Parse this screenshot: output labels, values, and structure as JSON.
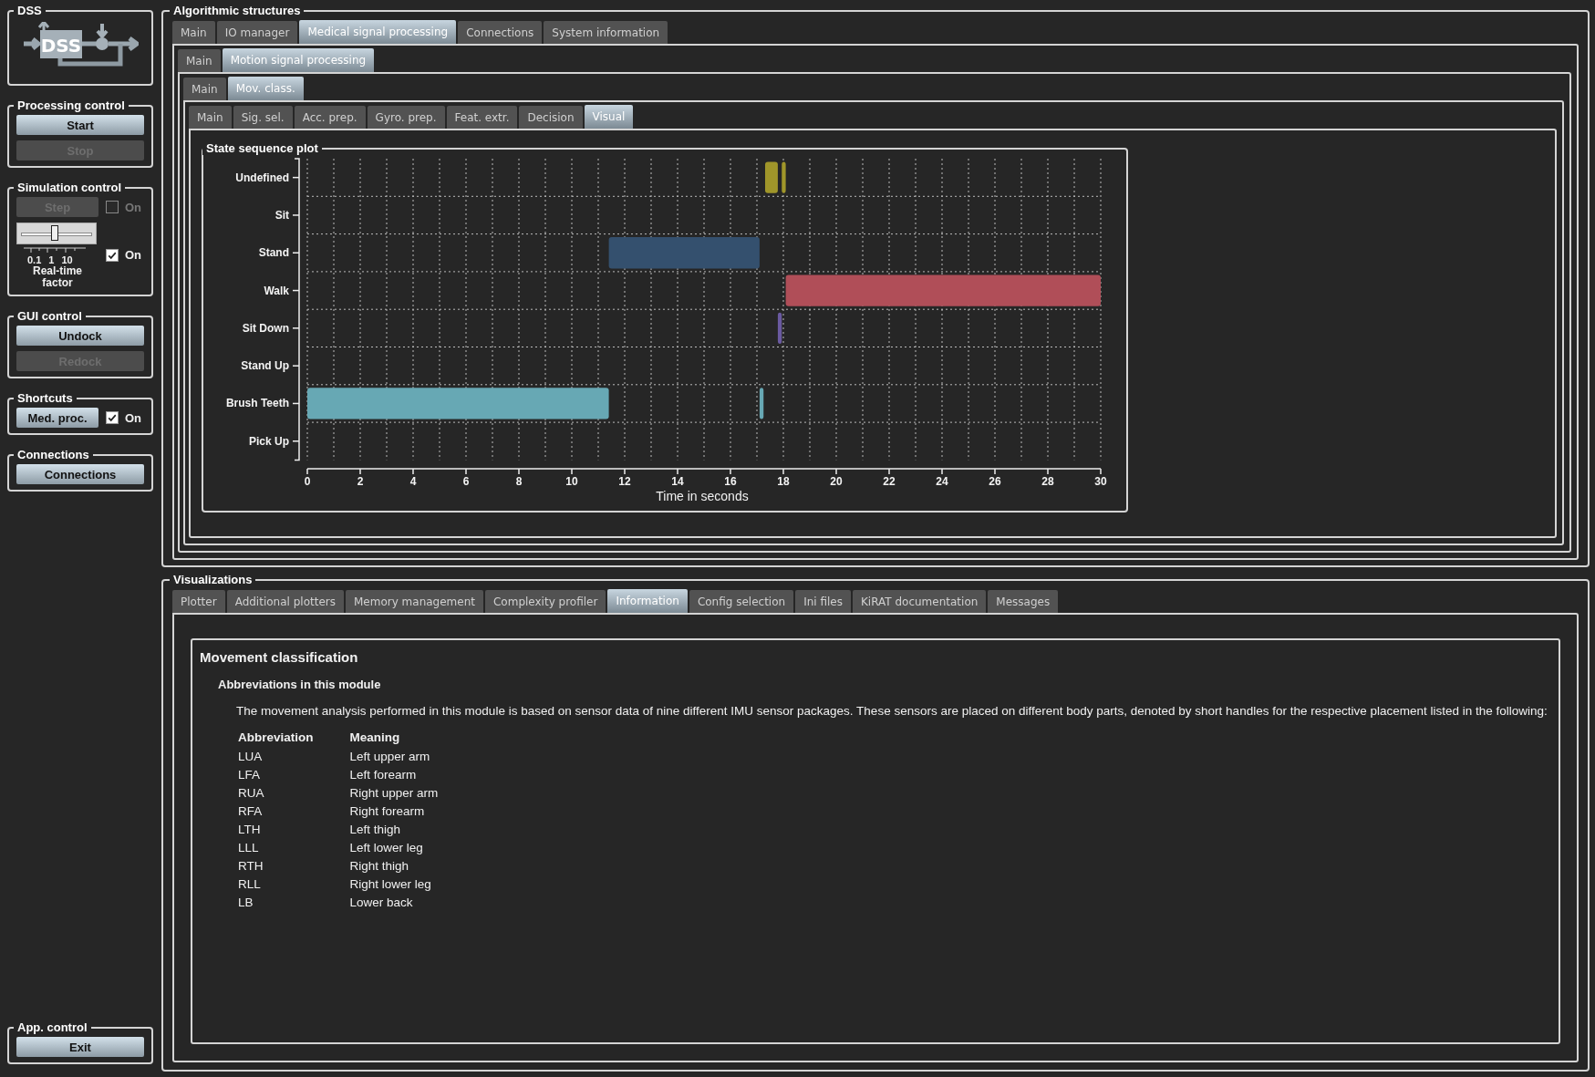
{
  "sidebar": {
    "groups": [
      {
        "kind": "logo",
        "title": "DSS",
        "logo_text": "DSS"
      },
      {
        "kind": "buttons",
        "title": "Processing control",
        "buttons": [
          {
            "label": "Start",
            "disabled": false
          },
          {
            "label": "Stop",
            "disabled": true
          }
        ]
      },
      {
        "kind": "simulation",
        "title": "Simulation control",
        "step": {
          "label": "Step",
          "disabled": true
        },
        "step_toggle": {
          "label": "On",
          "checked": false,
          "disabled": true
        },
        "slider": {
          "level": 0.49,
          "ticks": [
            "0.1",
            "1",
            "10"
          ],
          "caption": "Real-time factor"
        },
        "realtime_toggle": {
          "label": "On",
          "checked": true,
          "disabled": false
        }
      },
      {
        "kind": "buttons",
        "title": "GUI control",
        "buttons": [
          {
            "label": "Undock",
            "disabled": false
          },
          {
            "label": "Redock",
            "disabled": true
          }
        ]
      },
      {
        "kind": "shortcut",
        "title": "Shortcuts",
        "button": {
          "label": "Med. proc.",
          "disabled": false
        },
        "toggle": {
          "label": "On",
          "checked": true,
          "disabled": false
        }
      },
      {
        "kind": "buttons",
        "title": "Connections",
        "buttons": [
          {
            "label": "Connections",
            "disabled": false
          }
        ]
      }
    ],
    "app_control": {
      "title": "App. control",
      "buttons": [
        {
          "label": "Exit",
          "disabled": false
        }
      ]
    }
  },
  "algorithmic_structures": {
    "title": "Algorithmic structures",
    "tabs": [
      {
        "label": "Main",
        "selected": false
      },
      {
        "label": "IO manager",
        "selected": false
      },
      {
        "label": "Medical signal processing",
        "selected": true
      },
      {
        "label": "Connections",
        "selected": false
      },
      {
        "label": "System information",
        "selected": false
      }
    ],
    "panel": {
      "tabs": [
        {
          "label": "Main",
          "selected": false
        },
        {
          "label": "Motion signal processing",
          "selected": true
        }
      ],
      "panel": {
        "tabs": [
          {
            "label": "Main",
            "selected": false
          },
          {
            "label": "Mov. class.",
            "selected": true
          }
        ],
        "panel": {
          "tabs": [
            {
              "label": "Main",
              "selected": false
            },
            {
              "label": "Sig. sel.",
              "selected": false
            },
            {
              "label": "Acc. prep.",
              "selected": false
            },
            {
              "label": "Gyro. prep.",
              "selected": false
            },
            {
              "label": "Feat. extr.",
              "selected": false
            },
            {
              "label": "Decision",
              "selected": false
            },
            {
              "label": "Visual",
              "selected": true
            }
          ],
          "plot": {
            "title": "State sequence plot",
            "y_labels": [
              "Undefined",
              "Sit",
              "Stand",
              "Walk",
              "Sit Down",
              "Stand Up",
              "Brush Teeth",
              "Pick Up"
            ],
            "x_tick_labels": [
              "0",
              "2",
              "4",
              "6",
              "8",
              "10",
              "12",
              "14",
              "16",
              "18",
              "20",
              "22",
              "24",
              "26",
              "28",
              "30"
            ],
            "xlabel": "Time in seconds"
          }
        }
      }
    }
  },
  "visualizations": {
    "title": "Visualizations",
    "tabs": [
      {
        "label": "Plotter",
        "selected": false
      },
      {
        "label": "Additional plotters",
        "selected": false
      },
      {
        "label": "Memory management",
        "selected": false
      },
      {
        "label": "Complexity profiler",
        "selected": false
      },
      {
        "label": "Information",
        "selected": true
      },
      {
        "label": "Config selection",
        "selected": false
      },
      {
        "label": "Ini files",
        "selected": false
      },
      {
        "label": "KiRAT documentation",
        "selected": false
      },
      {
        "label": "Messages",
        "selected": false
      }
    ],
    "info": {
      "heading": "Movement classification",
      "subheading": "Abbreviations in this module",
      "paragraph": "The movement analysis performed in this module is based on sensor data of nine different IMU sensor packages. These sensors are placed on different body parts, denoted by short handles for the respective placement listed in the following:",
      "columns": [
        "Abbreviation",
        "Meaning"
      ],
      "rows": [
        [
          "LUA",
          "Left upper arm"
        ],
        [
          "LFA",
          "Left forearm"
        ],
        [
          "RUA",
          "Right upper arm"
        ],
        [
          "RFA",
          "Right forearm"
        ],
        [
          "LTH",
          "Left thigh"
        ],
        [
          "LLL",
          "Left lower leg"
        ],
        [
          "RTH",
          "Right thigh"
        ],
        [
          "RLL",
          "Right lower leg"
        ],
        [
          "LB",
          "Lower back"
        ]
      ]
    }
  }
}
